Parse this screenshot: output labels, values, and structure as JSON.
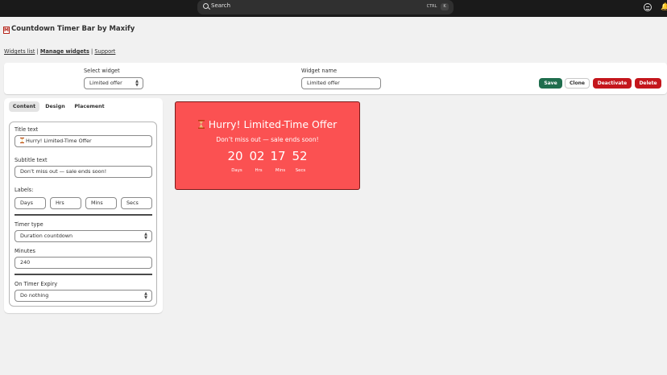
{
  "topbar": {
    "search_placeholder": "Search",
    "shortcut_ctrl": "CTRL",
    "shortcut_key": "K"
  },
  "app": {
    "title": "Countdown Timer Bar by Maxify",
    "logo_letter": "M"
  },
  "nav": {
    "widgets_list": "Widgets list",
    "manage_widgets": "Manage widgets",
    "support": "Support",
    "separator": "|"
  },
  "toolbar": {
    "select_widget_label": "Select widget",
    "select_widget_value": "Limited offer",
    "widget_name_label": "Widget name",
    "widget_name_value": "Limited offer",
    "save_label": "Save",
    "clone_label": "Clone",
    "deactivate_label": "Deactivate",
    "delete_label": "Delete"
  },
  "tabs": [
    "Content",
    "Design",
    "Placement"
  ],
  "form": {
    "title_text_label": "Title text",
    "title_text_value": "Hurry! Limited-Time Offer",
    "subtitle_text_label": "Subtitle text",
    "subtitle_text_value": "Don’t miss out — sale ends soon!",
    "labels_label": "Labels:",
    "labels": [
      "Days",
      "Hrs",
      "Mins",
      "Secs"
    ],
    "timer_type_label": "Timer type",
    "timer_type_value": "Duration countdown",
    "minutes_label": "Minutes",
    "minutes_value": "240",
    "expiry_label": "On Timer Expiry",
    "expiry_value": "Do nothing"
  },
  "preview": {
    "title": "Hurry! Limited-Time Offer",
    "subtitle": "Don’t miss out — sale ends soon!",
    "units": [
      {
        "value": "20",
        "label": "Days"
      },
      {
        "value": "02",
        "label": "Hrs"
      },
      {
        "value": "17",
        "label": "Mins"
      },
      {
        "value": "52",
        "label": "Secs"
      }
    ],
    "background_color": "#fb5152"
  },
  "colors": {
    "topbar": "#1a1a1a",
    "save": "#1f6d4d",
    "danger": "#c4161c"
  }
}
